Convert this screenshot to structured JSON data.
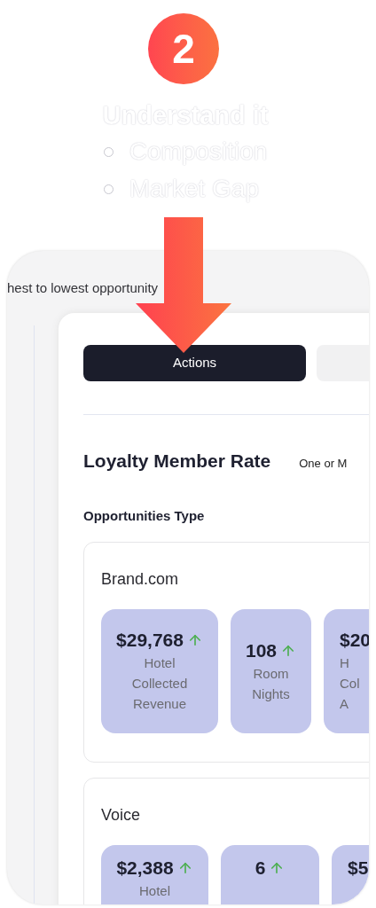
{
  "step": {
    "number": "2",
    "title": "Understand it",
    "bullets": [
      "Composition",
      "Market Gap"
    ]
  },
  "screen": {
    "caption": "hest to lowest opportunity",
    "tabs": [
      {
        "label": "Actions",
        "selected": true
      },
      {
        "selected": false
      }
    ],
    "metric_title": "Loyalty Member Rate",
    "metric_note": "One or M",
    "section_title": "Opportunities Type",
    "groups": [
      {
        "name": "Brand.com",
        "tiles": [
          {
            "kind": "full",
            "value": "$29,768",
            "label": [
              "Hotel",
              "Collected",
              "Revenue"
            ]
          },
          {
            "kind": "full",
            "value": "108",
            "label": [
              "Room",
              "Nights"
            ]
          },
          {
            "kind": "partial",
            "value": "$20",
            "label": [
              "H",
              "Col",
              "A"
            ]
          }
        ]
      },
      {
        "name": "Voice",
        "tiles": [
          {
            "kind": "full",
            "value": "$2,388",
            "label": [
              "Hotel"
            ]
          },
          {
            "kind": "full",
            "value": "6"
          },
          {
            "kind": "partial",
            "value": "$5"
          }
        ]
      }
    ]
  }
}
